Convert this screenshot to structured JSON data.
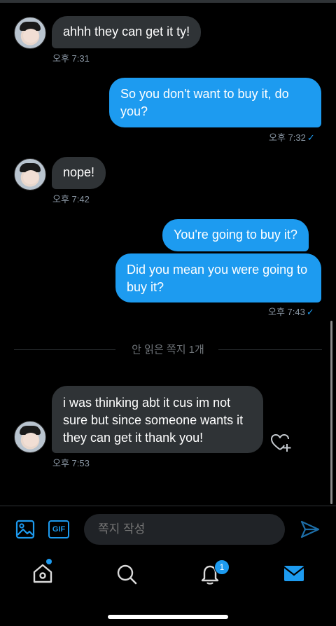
{
  "messages": [
    {
      "text": "ahhh they can get it ty!",
      "time": "오후 7:31"
    },
    {
      "text": "So you don't want to buy it, do you?",
      "time": "오후 7:32"
    },
    {
      "text": "nope!",
      "time": "오후 7:42"
    },
    {
      "text": "You're going to buy it?"
    },
    {
      "text": "Did you mean you were going to buy it?",
      "time": "오후 7:43"
    },
    {
      "text": "i was thinking abt it cus im not sure but since someone wants it they can get it thank you!",
      "time": "오후 7:53"
    }
  ],
  "read_check": "✓",
  "unread_divider": "안 읽은 쪽지 1개",
  "composer": {
    "placeholder": "쪽지 작성",
    "gif_label": "GIF"
  },
  "nav": {
    "notification_count": "1"
  },
  "icons": [
    "image-icon",
    "gif-icon",
    "send-icon",
    "home-icon",
    "search-icon",
    "bell-icon",
    "mail-icon",
    "heart-plus-icon"
  ],
  "colors": {
    "accent": "#1d9bf0",
    "incoming_bubble": "#2f3336",
    "background": "#000000"
  }
}
